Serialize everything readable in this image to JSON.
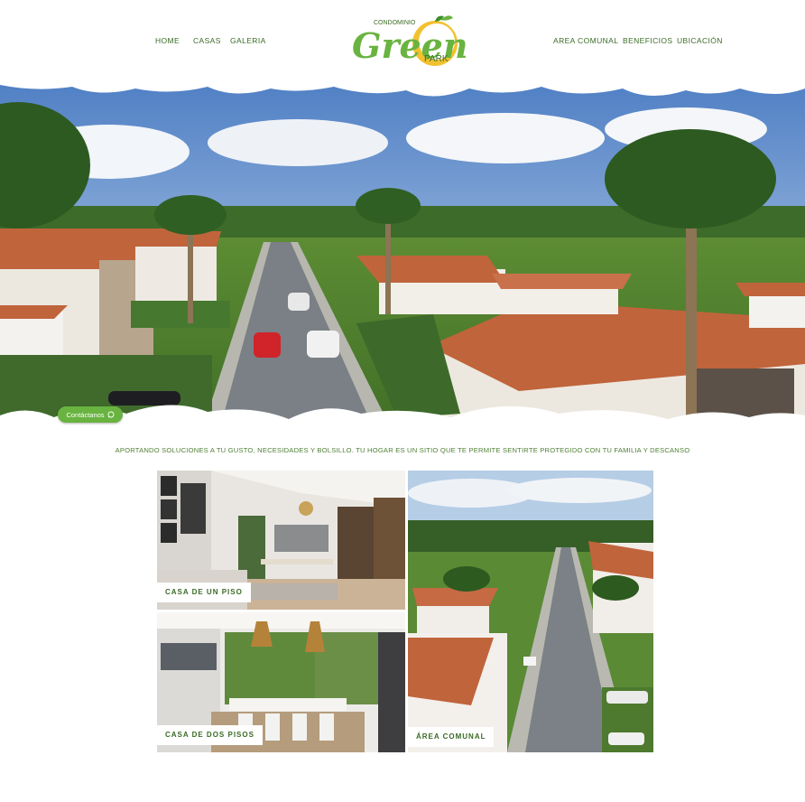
{
  "nav": {
    "home": "HOME",
    "casas": "CASAS",
    "galeria": "GALERIA",
    "area_comunal": "AREA COMUNAL",
    "beneficios": "BENEFICIOS",
    "ubicacion": "UBICACIÓN"
  },
  "logo": {
    "top": "CONDOMINIO",
    "main": "Green",
    "bottom": "PARK"
  },
  "hero": {
    "contact_label": "Contáctanos",
    "contact_icon": "whatsapp-icon"
  },
  "tagline": "APORTANDO SOLUCIONES A TU GUSTO, NECESIDADES Y BOLSILLO. TU HOGAR ES UN SITIO QUE TE PERMITE SENTIRTE PROTEGIDO CON TU FAMILIA Y DESCANSO",
  "gallery": {
    "casa_un_piso": "CASA DE UN PISO",
    "casa_dos_pisos": "CASA DE DOS PISOS",
    "area_comunal": "ÁREA COMUNAL"
  },
  "colors": {
    "brand_green": "#69b340",
    "nav_green": "#3a6b25",
    "logo_yellow": "#f2c12e",
    "roof_terracotta": "#c0643c"
  }
}
